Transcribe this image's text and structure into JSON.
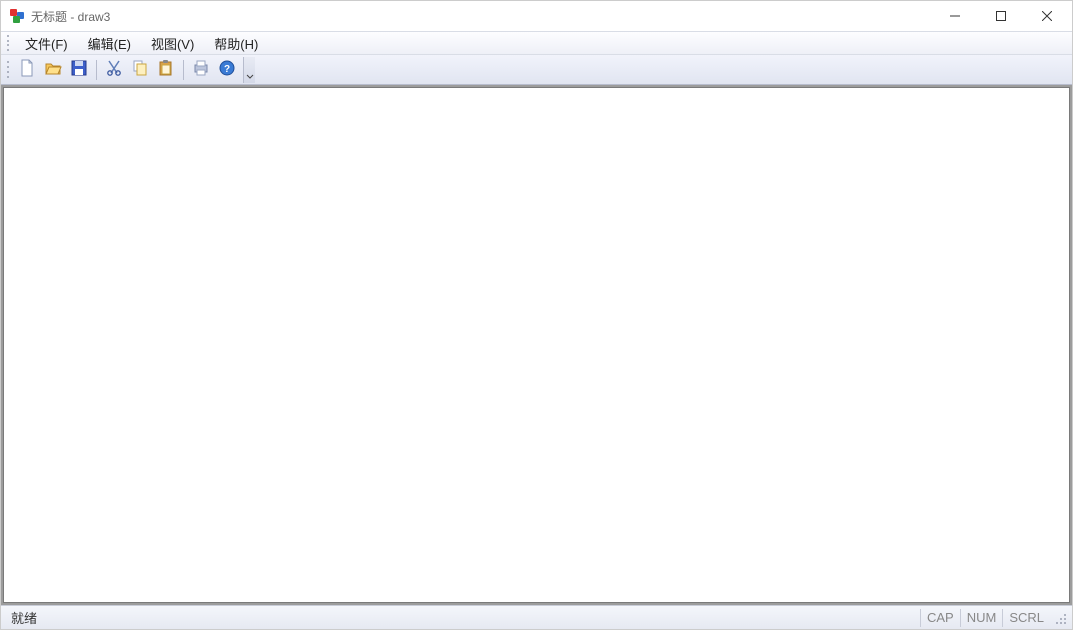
{
  "titlebar": {
    "title": "无标题 - draw3"
  },
  "menu": {
    "file": "文件(F)",
    "edit": "编辑(E)",
    "view": "视图(V)",
    "help": "帮助(H)"
  },
  "toolbar_icons": {
    "new": "new-file-icon",
    "open": "open-folder-icon",
    "save": "save-disk-icon",
    "cut": "cut-scissors-icon",
    "copy": "copy-icon",
    "paste": "paste-icon",
    "print": "print-icon",
    "help": "help-about-icon"
  },
  "statusbar": {
    "ready": "就绪",
    "cap": "CAP",
    "num": "NUM",
    "scrl": "SCRL"
  }
}
